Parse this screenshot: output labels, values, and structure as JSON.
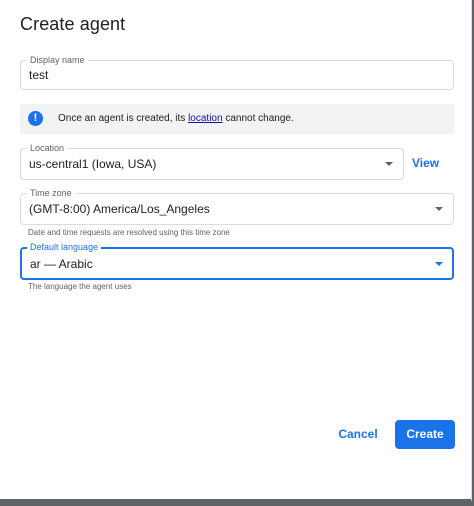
{
  "dialog": {
    "title": "Create agent"
  },
  "display_name": {
    "label": "Display name",
    "value": "test"
  },
  "info_banner": {
    "icon": "info-icon",
    "text_before": "Once an agent is created, its ",
    "link": "location",
    "text_after": " cannot change."
  },
  "location": {
    "label": "Location",
    "value": "us-central1 (Iowa, USA)",
    "view_label": "View"
  },
  "time_zone": {
    "label": "Time zone",
    "value": "(GMT-8:00) America/Los_Angeles",
    "hint": "Date and time requests are resolved using this time zone"
  },
  "default_language": {
    "label": "Default language",
    "value": "ar — Arabic",
    "hint": "The language the agent uses"
  },
  "actions": {
    "cancel_label": "Cancel",
    "create_label": "Create"
  },
  "colors": {
    "accent": "#1a73e8",
    "banner_bg": "#f1f3f4",
    "text": "#202124",
    "muted": "#5f6368"
  }
}
